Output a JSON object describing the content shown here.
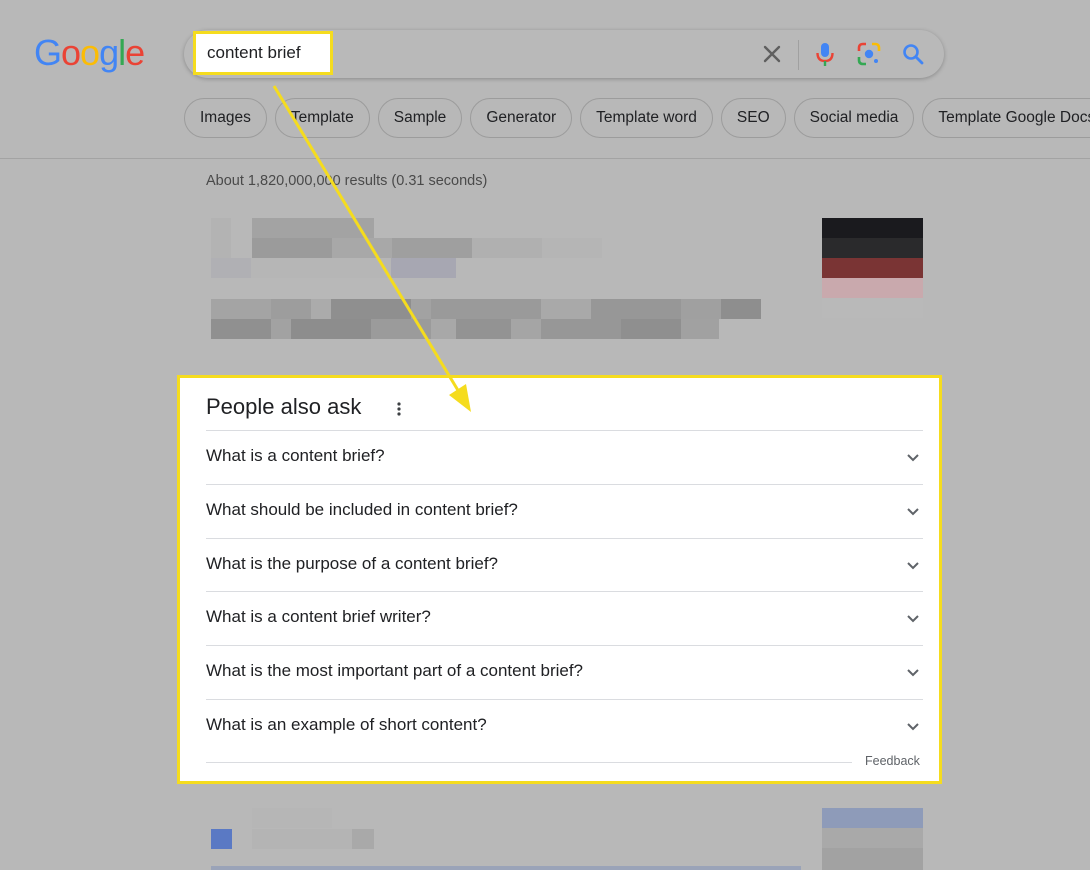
{
  "logo": {
    "letters": [
      "G",
      "o",
      "o",
      "g",
      "l",
      "e"
    ]
  },
  "colors": {
    "logo_blue": "#4285F4",
    "logo_red": "#EA4335",
    "logo_yellow": "#FBBC05",
    "logo_green": "#34A853",
    "highlight": "#F5DC1E",
    "page_dim": "#B8B8B8"
  },
  "search": {
    "query": "content brief",
    "icons": [
      "clear-icon",
      "microphone-icon",
      "google-lens-icon",
      "search-icon"
    ]
  },
  "chips": [
    "Images",
    "Template",
    "Sample",
    "Generator",
    "Template word",
    "SEO",
    "Social media",
    "Template Google Docs"
  ],
  "results": {
    "stats": "About 1,820,000,000 results (0.31 seconds)"
  },
  "paa": {
    "title": "People also ask",
    "questions": [
      "What is a content brief?",
      "What should be included in content brief?",
      "What is the purpose of a content brief?",
      "What is a content brief writer?",
      "What is the most important part of a content brief?",
      "What is an example of short content?"
    ],
    "feedback": "Feedback"
  }
}
